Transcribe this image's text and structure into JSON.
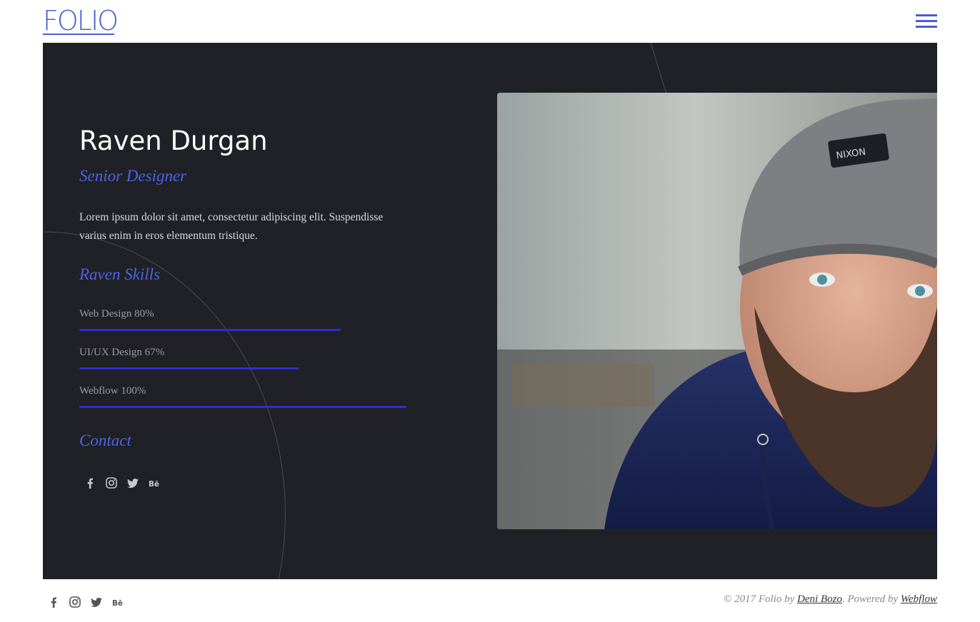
{
  "header": {
    "logo_text": "FOLIO",
    "menu_icon": "hamburger-menu-icon"
  },
  "profile": {
    "name": "Raven Durgan",
    "role": "Senior Designer",
    "bio": "Lorem ipsum dolor sit amet, consectetur adipiscing elit. Suspendisse varius enim in eros elementum tristique."
  },
  "skills": {
    "title": "Raven Skills",
    "items": [
      {
        "label": "Web Design 80%",
        "percent": 80
      },
      {
        "label": "UI/UX Design 67%",
        "percent": 67
      },
      {
        "label": "Webflow 100%",
        "percent": 100
      }
    ]
  },
  "contact": {
    "title": "Contact",
    "icons": [
      "facebook-icon",
      "instagram-icon",
      "twitter-icon",
      "behance-icon"
    ]
  },
  "footer": {
    "copy_prefix": "© 2017 Folio by ",
    "author_link": "Deni Bozo",
    "powered_text": ". Powered by ",
    "platform_link": "Webflow"
  },
  "colors": {
    "accent": "#4b63e6",
    "hero_bg": "#202126",
    "skill_bar": "#2e2fd6",
    "logo": "#4a5fd0"
  }
}
